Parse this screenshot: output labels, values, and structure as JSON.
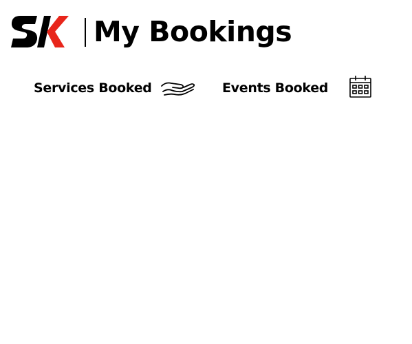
{
  "header": {
    "logo_text": "SK",
    "title": "My Bookings"
  },
  "tabs": [
    {
      "label": "Services Booked",
      "icon": "hand-icon"
    },
    {
      "label": "Events Booked",
      "icon": "calendar-icon"
    }
  ],
  "colors": {
    "brand_black": "#000000",
    "brand_red": "#e8261b",
    "background": "#ffffff"
  }
}
